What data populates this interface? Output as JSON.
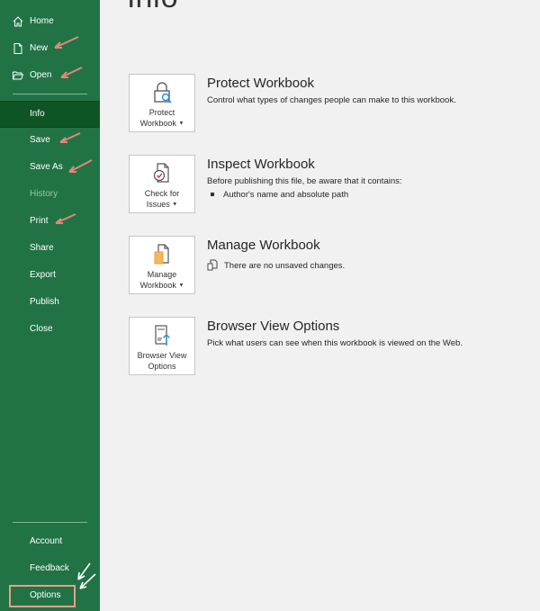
{
  "page": {
    "title": "Info"
  },
  "sidebar": {
    "items": [
      {
        "label": "Home",
        "icon": "home-icon"
      },
      {
        "label": "New",
        "icon": "new-document-icon"
      },
      {
        "label": "Open",
        "icon": "open-folder-icon"
      },
      {
        "label": "Info",
        "state": "active"
      },
      {
        "label": "Save"
      },
      {
        "label": "Save As"
      },
      {
        "label": "History",
        "state": "disabled"
      },
      {
        "label": "Print"
      },
      {
        "label": "Share"
      },
      {
        "label": "Export"
      },
      {
        "label": "Publish"
      },
      {
        "label": "Close"
      }
    ],
    "bottom_items": [
      {
        "label": "Account"
      },
      {
        "label": "Feedback"
      },
      {
        "label": "Options",
        "highlighted": true
      }
    ]
  },
  "sections": [
    {
      "button_line1": "Protect",
      "button_line2": "Workbook",
      "has_dropdown": true,
      "icon": "lock-key-icon",
      "title": "Protect Workbook",
      "description": "Control what types of changes people can make to this workbook."
    },
    {
      "button_line1": "Check for",
      "button_line2": "Issues",
      "has_dropdown": true,
      "icon": "inspect-document-icon",
      "title": "Inspect Workbook",
      "description": "Before publishing this file, be aware that it contains:",
      "bullets": [
        "Author's name and absolute path"
      ]
    },
    {
      "button_line1": "Manage",
      "button_line2": "Workbook",
      "has_dropdown": true,
      "icon": "manage-workbook-icon",
      "title": "Manage Workbook",
      "description": "There are no unsaved changes."
    },
    {
      "button_line1": "Browser View",
      "button_line2": "Options",
      "has_dropdown": false,
      "icon": "browser-view-icon",
      "title": "Browser View Options",
      "description": "Pick what users can see when this workbook is viewed on the Web."
    }
  ],
  "colors": {
    "sidebar_bg": "#217346",
    "active_bg": "#0e5424",
    "annotation_arrow": "#e8857a",
    "highlight_box": "#e59f8f"
  }
}
